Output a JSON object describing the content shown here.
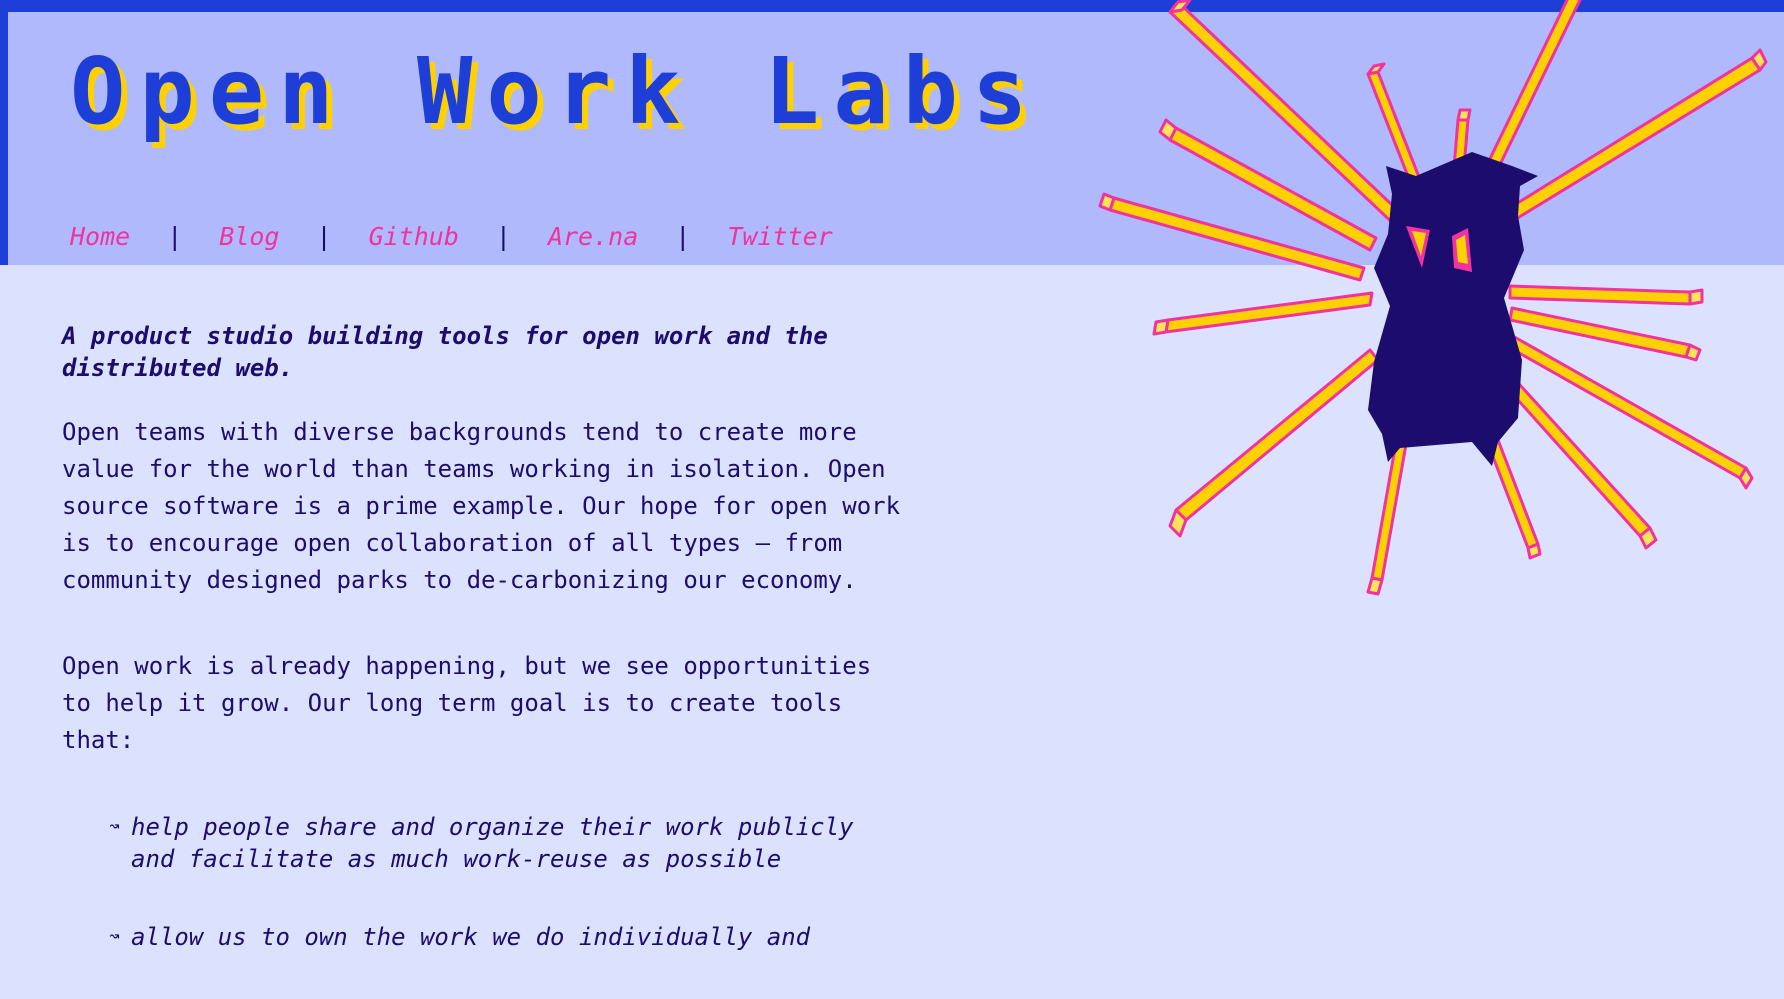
{
  "site": {
    "title": "Open Work Labs"
  },
  "nav": {
    "links": [
      "Home",
      "Blog",
      "Github",
      "Are.na",
      "Twitter"
    ],
    "separator": "|"
  },
  "content": {
    "tagline": "A product studio building tools for open work and the distributed web.",
    "paragraph_1": "Open teams with diverse backgrounds tend to create more value for the world than teams working in isolation. Open source software is a prime example. Our hope for open work is to encourage open collaboration of all types – from community designed parks to de-carbonizing our economy.",
    "paragraph_2": "Open work is already happening, but we see opportunities to help it grow. Our long term goal is to create tools that:",
    "goals": [
      "help people share and organize their work publicly and facilitate as much work-reuse as possible",
      "allow us to own the work we do individually and"
    ],
    "bullet": "↝"
  },
  "mascot": {
    "icon": "radiant-creature-illustration"
  },
  "colors": {
    "header_bg": "#b0b9fb",
    "page_bg": "#dce2fd",
    "accent_blue": "#1e3fd7",
    "title_shadow": "#ffd100",
    "link_pink": "#f0339f",
    "text_dark": "#1b0c6e",
    "ray_yellow": "#ffd100"
  }
}
